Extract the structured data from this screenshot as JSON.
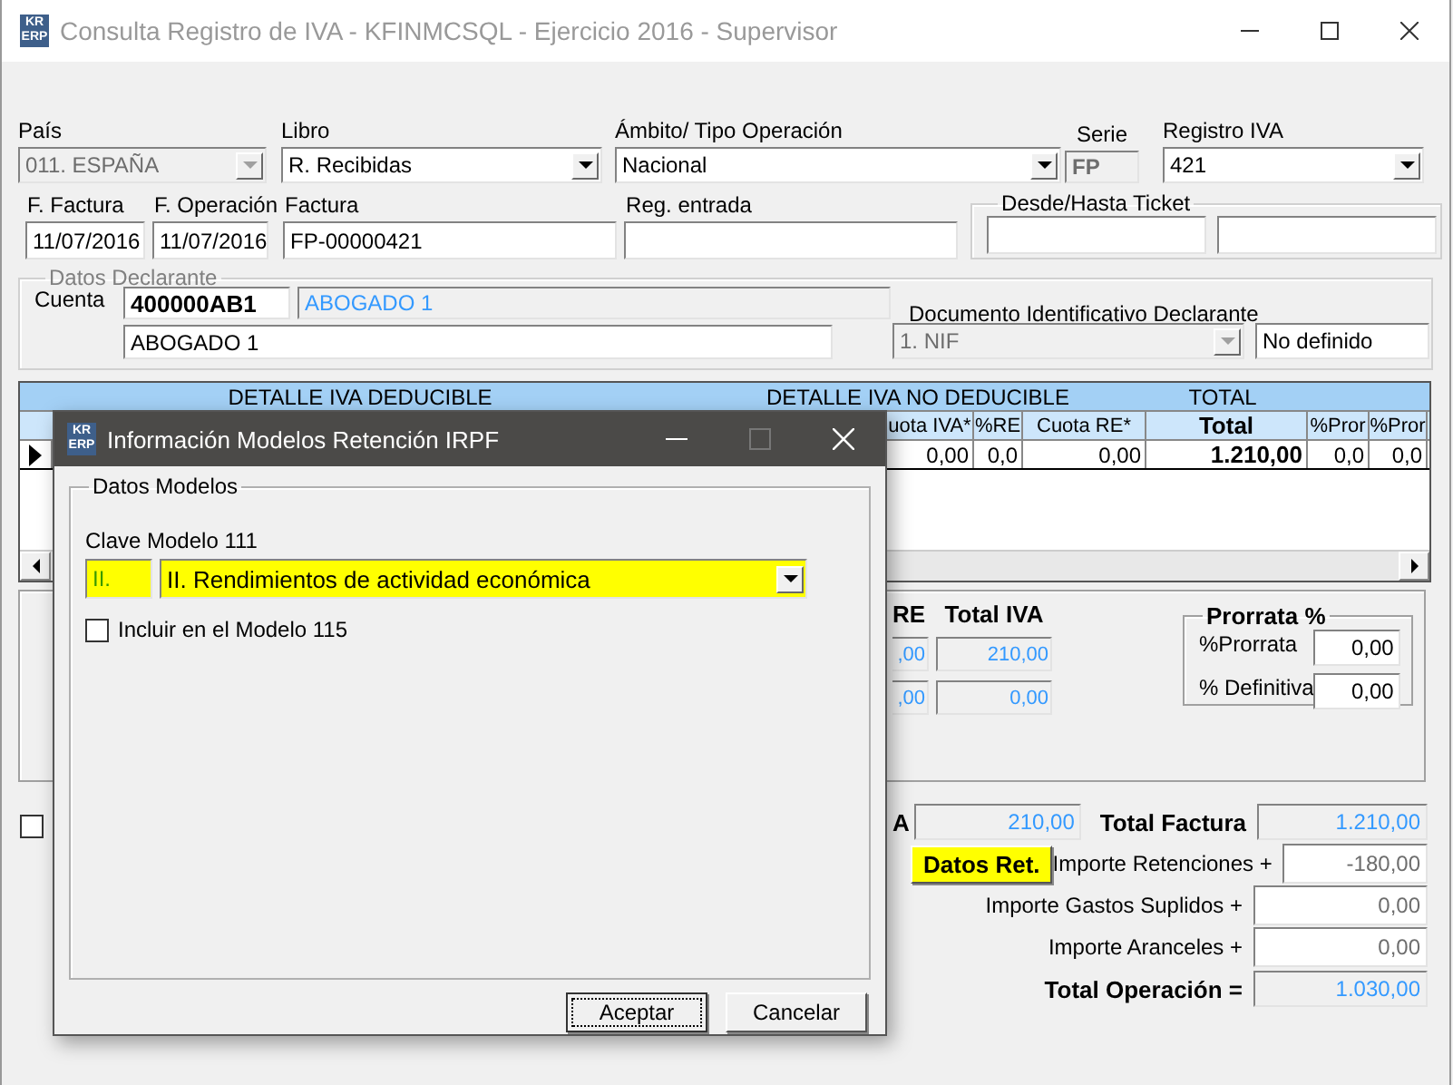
{
  "window": {
    "icon": [
      "KR",
      "ERP"
    ],
    "title": "Consulta Registro de IVA - KFINMCSQL - Ejercicio 2016 - Supervisor"
  },
  "header_fields": [
    {
      "label": "País",
      "kind": "combo",
      "value": "011.  ESPAÑA",
      "disabled": true
    },
    {
      "label": "Libro",
      "kind": "combo",
      "value": "R. Recibidas",
      "disabled": false
    },
    {
      "label": "Ámbito/ Tipo Operación",
      "kind": "combo",
      "value": "Nacional",
      "disabled": false
    },
    {
      "label": "Serie",
      "kind": "text",
      "value": "FP",
      "disabled": true
    },
    {
      "label": "Registro IVA",
      "kind": "combo",
      "value": "421",
      "disabled": false
    }
  ],
  "document_fields": [
    {
      "label": "F. Factura",
      "value": "11/07/2016"
    },
    {
      "label": "F. Operación",
      "value": "11/07/2016"
    },
    {
      "label": "Factura",
      "value": "FP-00000421"
    },
    {
      "label": "Reg. entrada"
    }
  ],
  "ticket_range": {
    "title": "Desde/Hasta Ticket"
  },
  "declarant": {
    "title": "Datos Declarante",
    "account_label": "Cuenta",
    "account": "400000AB1",
    "account_name": "ABOGADO 1",
    "name": "ABOGADO 1",
    "document_label": "Documento Identificativo Declarante",
    "document_type": "1. NIF",
    "document_number": "No definido"
  },
  "grid": {
    "group_headers": [
      "DETALLE IVA DEDUCIBLE",
      "DETALLE IVA NO DEDUCIBLE",
      "TOTAL"
    ],
    "columns": [
      "uota IVA*",
      "%RE",
      "Cuota RE*",
      "Total",
      "%Pror",
      "%Pror"
    ],
    "rows": [
      {
        "selected": true,
        "cells": [
          "0,00",
          "0,0",
          "0,00",
          "1.210,00",
          "0,0",
          "0,0"
        ]
      }
    ]
  },
  "vat_totals": {
    "columns": [
      "RE",
      "Total IVA"
    ],
    "rows": [
      [
        ",00",
        "210,00"
      ],
      [
        ",00",
        "0,00"
      ]
    ]
  },
  "prorrata": {
    "title": "Prorrata %",
    "fields": [
      {
        "label": "%Prorrata",
        "value": "0,00"
      },
      {
        "label": "% Definitiva",
        "value": "0,00"
      }
    ]
  },
  "footer": {
    "checkbox": {
      "checked": false
    },
    "base_label": "A",
    "base_value": "210,00",
    "retention_button": {
      "label": "Datos Ret.",
      "highlighted": true
    },
    "amounts": [
      {
        "label": "Total Factura",
        "value": "1.210,00",
        "kind": "total"
      },
      {
        "label": "Importe Retenciones +",
        "value": "-180,00",
        "kind": "input"
      },
      {
        "label": "Importe Gastos Suplidos +",
        "value": "0,00",
        "kind": "input"
      },
      {
        "label": "Importe Aranceles +",
        "value": "0,00",
        "kind": "input"
      },
      {
        "label": "Total Operación =",
        "value": "1.030,00",
        "kind": "total"
      }
    ]
  },
  "dialog": {
    "icon": [
      "KR",
      "ERP"
    ],
    "title": "Información Modelos Retención IRPF",
    "group": "Datos Modelos",
    "key_label": "Clave Modelo 111",
    "key_code": "II.",
    "key_value": "II. Rendimientos de actividad económica",
    "highlighted": true,
    "include_115": {
      "label": "Incluir en el Modelo 115",
      "checked": false
    },
    "buttons": [
      {
        "label": "Aceptar",
        "focused": true
      },
      {
        "label": "Cancelar",
        "focused": false
      }
    ]
  }
}
